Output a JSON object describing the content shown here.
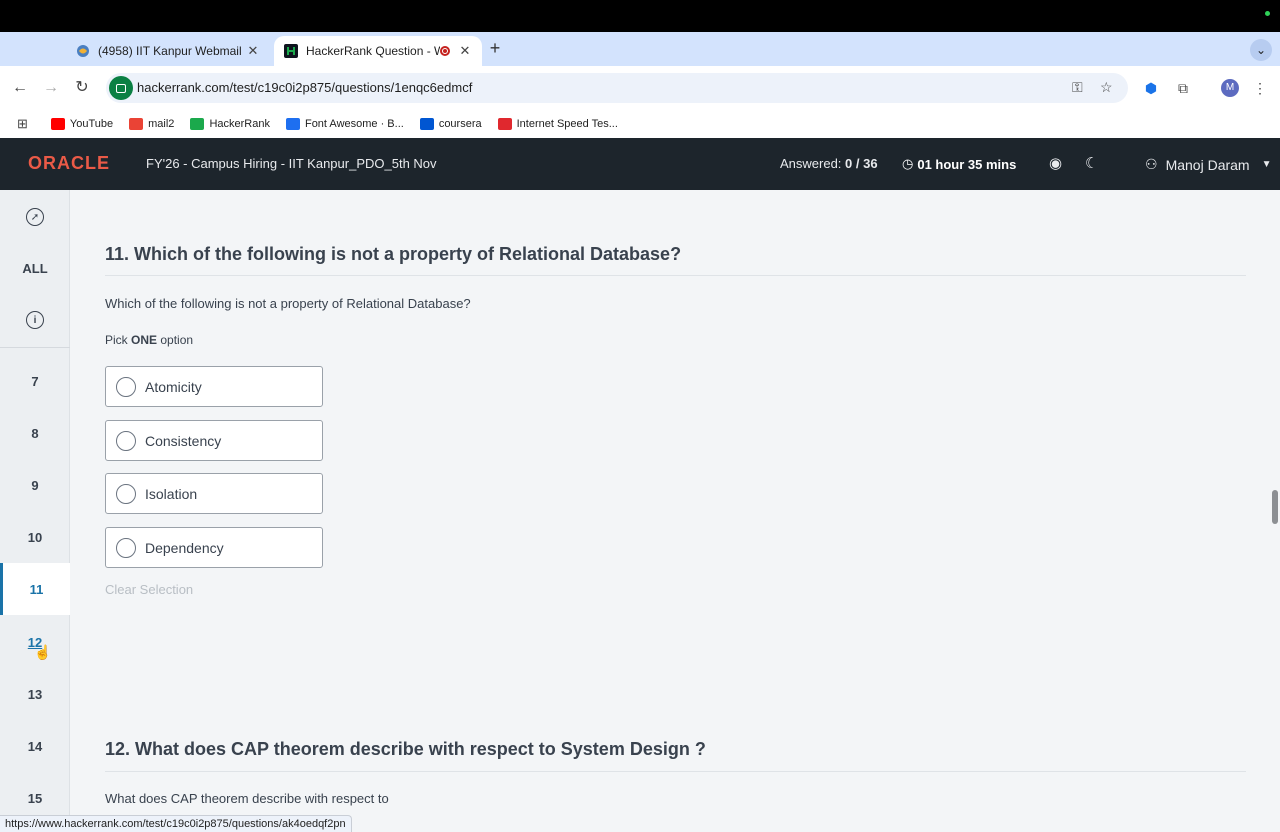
{
  "browser": {
    "tabs": [
      {
        "title": "(4958) IIT Kanpur Webmail ::",
        "active": false
      },
      {
        "title": "HackerRank Question - W",
        "active": true
      }
    ],
    "new_tab_icon": "plus-icon",
    "url": "hackerrank.com/test/c19c0i2p875/questions/1enqc6edmcf",
    "profile_initial": "M",
    "bookmarks": [
      {
        "label": "YouTube",
        "color": "#ff0000"
      },
      {
        "label": "mail2",
        "color": "#ea4335"
      },
      {
        "label": "HackerRank",
        "color": "#1ba94c"
      },
      {
        "label": "Font Awesome · B...",
        "color": "#1e6ff0"
      },
      {
        "label": "coursera",
        "color": "#0056d2"
      },
      {
        "label": "Internet Speed Tes...",
        "color": "#e0282e"
      }
    ],
    "status_url": "https://www.hackerrank.com/test/c19c0i2p875/questions/ak4oedqf2pn"
  },
  "header": {
    "logo": "ORACLE",
    "test_name": "FY'26 - Campus Hiring - IIT Kanpur_PDO_5th Nov",
    "answered_label": "Answered:",
    "answered_value": "0 / 36",
    "timer": "01 hour 35 mins",
    "user_name": "Manoj Daram",
    "colors": {
      "header_bg": "#1d252c",
      "logo": "#ea5a47",
      "accent": "#1a73a8"
    }
  },
  "sidebar": {
    "all_label": "ALL",
    "numbers": [
      "7",
      "8",
      "9",
      "10",
      "11",
      "12",
      "13",
      "14",
      "15"
    ],
    "current": "11"
  },
  "question11": {
    "title": "11. Which of the following is not a property of Relational Database?",
    "text": "Which of the following is not a property of Relational Database?",
    "pick_prefix": "Pick",
    "pick_strong": "ONE",
    "pick_suffix": "option",
    "options": [
      "Atomicity",
      "Consistency",
      "Isolation",
      "Dependency"
    ],
    "clear_label": "Clear Selection"
  },
  "question12": {
    "title": "12. What does CAP theorem describe with respect to System Design ?",
    "text": "What does CAP theorem describe with respect to"
  }
}
